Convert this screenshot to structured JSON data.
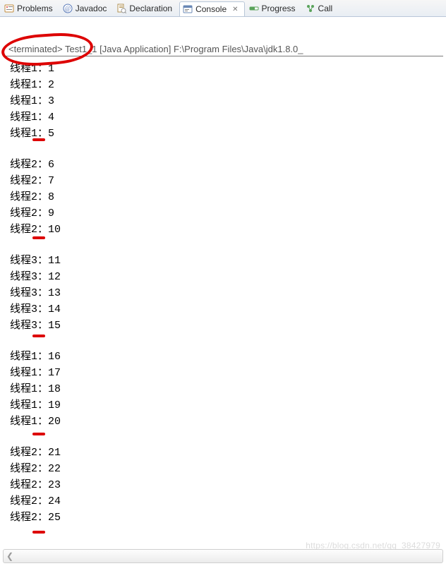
{
  "tabs": [
    {
      "id": "problems",
      "label": "Problems",
      "icon": "problems-icon"
    },
    {
      "id": "javadoc",
      "label": "Javadoc",
      "icon": "javadoc-icon"
    },
    {
      "id": "declaration",
      "label": "Declaration",
      "icon": "declaration-icon"
    },
    {
      "id": "console",
      "label": "Console",
      "icon": "console-icon",
      "active": true,
      "closable": true
    },
    {
      "id": "progress",
      "label": "Progress",
      "icon": "progress-icon"
    },
    {
      "id": "call",
      "label": "Call",
      "icon": "call-icon"
    }
  ],
  "run": {
    "status": "<terminated>",
    "app": "Test1_1",
    "kind": "[Java Application]",
    "path": "F:\\Program Files\\Java\\jdk1.8.0_"
  },
  "console_prefix": "线程",
  "console_sep": "：",
  "console_blocks": [
    {
      "thread": "1",
      "values": [
        "1",
        "2",
        "3",
        "4",
        "5"
      ]
    },
    {
      "thread": "2",
      "values": [
        "6",
        "7",
        "8",
        "9",
        "10"
      ]
    },
    {
      "thread": "3",
      "values": [
        "11",
        "12",
        "13",
        "14",
        "15"
      ]
    },
    {
      "thread": "1",
      "values": [
        "16",
        "17",
        "18",
        "19",
        "20"
      ]
    },
    {
      "thread": "2",
      "values": [
        "21",
        "22",
        "23",
        "24",
        "25"
      ]
    }
  ],
  "watermark": "https://blog.csdn.net/qq_38427979"
}
